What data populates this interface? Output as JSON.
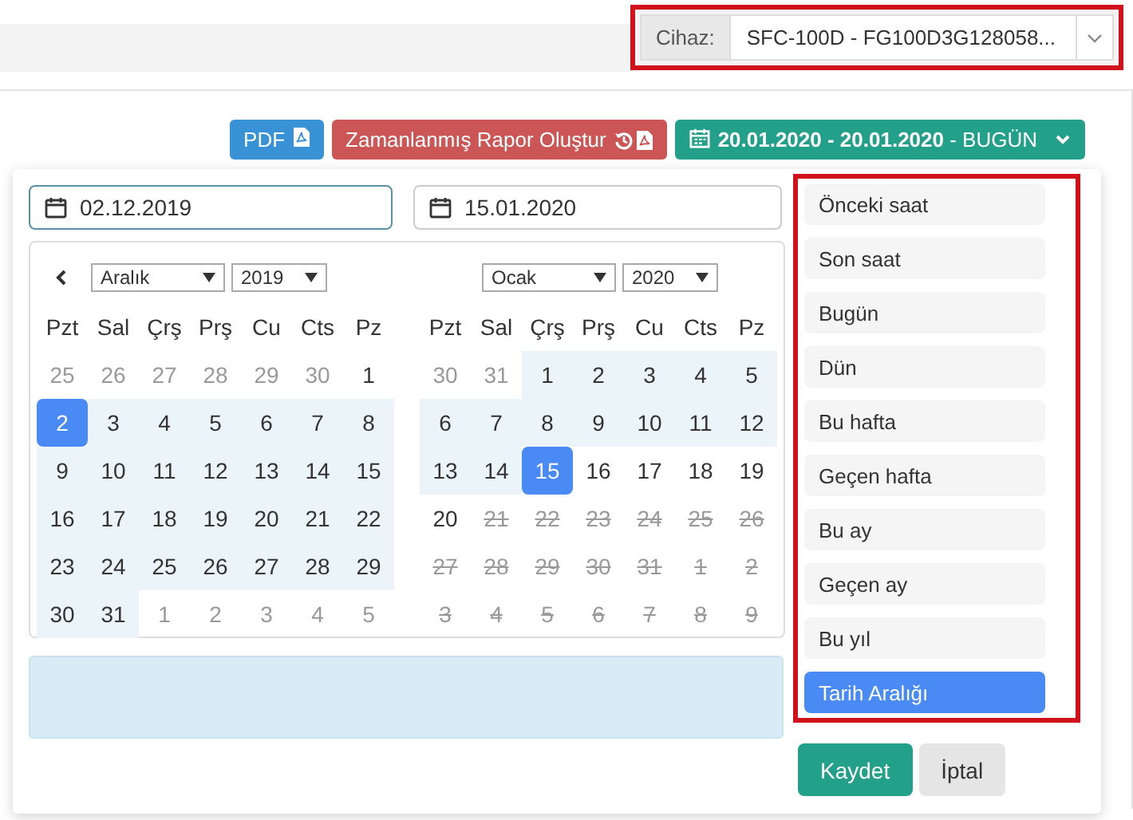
{
  "device_selector": {
    "label": "Cihaz:",
    "value": "SFC-100D - FG100D3G128058..."
  },
  "toolbar": {
    "pdf_button": "PDF",
    "scheduled_report_button": "Zamanlanmış Rapor Oluştur",
    "range_button": "**20.01.2020 - 20.01.2020** - BUGÜN"
  },
  "date_inputs": [
    {
      "value": "02.12.2019",
      "focused": true
    },
    {
      "value": "15.01.2020",
      "focused": false
    }
  ],
  "calendars": [
    {
      "month": "Aralık",
      "year": "2019",
      "weekdays": [
        "Pzt",
        "Sal",
        "Çrş",
        "Prş",
        "Cu",
        "Cts",
        "Pz"
      ],
      "days": [
        {
          "text": "25",
          "kind": "off"
        },
        {
          "text": "26",
          "kind": "off"
        },
        {
          "text": "27",
          "kind": "off"
        },
        {
          "text": "28",
          "kind": "off"
        },
        {
          "text": "29",
          "kind": "off"
        },
        {
          "text": "30",
          "kind": "off"
        },
        {
          "text": "1",
          "kind": "normal"
        },
        {
          "text": "2",
          "kind": "selected"
        },
        {
          "text": "3",
          "kind": "range"
        },
        {
          "text": "4",
          "kind": "range"
        },
        {
          "text": "5",
          "kind": "range"
        },
        {
          "text": "6",
          "kind": "range"
        },
        {
          "text": "7",
          "kind": "range"
        },
        {
          "text": "8",
          "kind": "range"
        },
        {
          "text": "9",
          "kind": "range"
        },
        {
          "text": "10",
          "kind": "range"
        },
        {
          "text": "11",
          "kind": "range"
        },
        {
          "text": "12",
          "kind": "range"
        },
        {
          "text": "13",
          "kind": "range"
        },
        {
          "text": "14",
          "kind": "range"
        },
        {
          "text": "15",
          "kind": "range"
        },
        {
          "text": "16",
          "kind": "range"
        },
        {
          "text": "17",
          "kind": "range"
        },
        {
          "text": "18",
          "kind": "range"
        },
        {
          "text": "19",
          "kind": "range"
        },
        {
          "text": "20",
          "kind": "range"
        },
        {
          "text": "21",
          "kind": "range"
        },
        {
          "text": "22",
          "kind": "range"
        },
        {
          "text": "23",
          "kind": "range"
        },
        {
          "text": "24",
          "kind": "range"
        },
        {
          "text": "25",
          "kind": "range"
        },
        {
          "text": "26",
          "kind": "range"
        },
        {
          "text": "27",
          "kind": "range"
        },
        {
          "text": "28",
          "kind": "range"
        },
        {
          "text": "29",
          "kind": "range"
        },
        {
          "text": "30",
          "kind": "range"
        },
        {
          "text": "31",
          "kind": "range"
        },
        {
          "text": "1",
          "kind": "off"
        },
        {
          "text": "2",
          "kind": "off"
        },
        {
          "text": "3",
          "kind": "off"
        },
        {
          "text": "4",
          "kind": "off"
        },
        {
          "text": "5",
          "kind": "off"
        }
      ]
    },
    {
      "month": "Ocak",
      "year": "2020",
      "weekdays": [
        "Pzt",
        "Sal",
        "Çrş",
        "Prş",
        "Cu",
        "Cts",
        "Pz"
      ],
      "days": [
        {
          "text": "30",
          "kind": "off"
        },
        {
          "text": "31",
          "kind": "off"
        },
        {
          "text": "1",
          "kind": "range"
        },
        {
          "text": "2",
          "kind": "range"
        },
        {
          "text": "3",
          "kind": "range"
        },
        {
          "text": "4",
          "kind": "range"
        },
        {
          "text": "5",
          "kind": "range"
        },
        {
          "text": "6",
          "kind": "range"
        },
        {
          "text": "7",
          "kind": "range"
        },
        {
          "text": "8",
          "kind": "range"
        },
        {
          "text": "9",
          "kind": "range"
        },
        {
          "text": "10",
          "kind": "range"
        },
        {
          "text": "11",
          "kind": "range"
        },
        {
          "text": "12",
          "kind": "range"
        },
        {
          "text": "13",
          "kind": "range"
        },
        {
          "text": "14",
          "kind": "range"
        },
        {
          "text": "15",
          "kind": "selected"
        },
        {
          "text": "16",
          "kind": "normal"
        },
        {
          "text": "17",
          "kind": "normal"
        },
        {
          "text": "18",
          "kind": "normal"
        },
        {
          "text": "19",
          "kind": "normal"
        },
        {
          "text": "20",
          "kind": "normal"
        },
        {
          "text": "21",
          "kind": "disabled"
        },
        {
          "text": "22",
          "kind": "disabled"
        },
        {
          "text": "23",
          "kind": "disabled"
        },
        {
          "text": "24",
          "kind": "disabled"
        },
        {
          "text": "25",
          "kind": "disabled"
        },
        {
          "text": "26",
          "kind": "disabled"
        },
        {
          "text": "27",
          "kind": "disabled"
        },
        {
          "text": "28",
          "kind": "disabled"
        },
        {
          "text": "29",
          "kind": "disabled"
        },
        {
          "text": "30",
          "kind": "disabled"
        },
        {
          "text": "31",
          "kind": "disabled"
        },
        {
          "text": "1",
          "kind": "disabled"
        },
        {
          "text": "2",
          "kind": "disabled"
        },
        {
          "text": "3",
          "kind": "disabled"
        },
        {
          "text": "4",
          "kind": "disabled"
        },
        {
          "text": "5",
          "kind": "disabled"
        },
        {
          "text": "6",
          "kind": "disabled"
        },
        {
          "text": "7",
          "kind": "disabled"
        },
        {
          "text": "8",
          "kind": "disabled"
        },
        {
          "text": "9",
          "kind": "disabled"
        }
      ]
    }
  ],
  "ranges": [
    {
      "label": "Önceki saat",
      "selected": false
    },
    {
      "label": "Son saat",
      "selected": false
    },
    {
      "label": "Bugün",
      "selected": false
    },
    {
      "label": "Dün",
      "selected": false
    },
    {
      "label": "Bu hafta",
      "selected": false
    },
    {
      "label": "Geçen hafta",
      "selected": false
    },
    {
      "label": "Bu ay",
      "selected": false
    },
    {
      "label": "Geçen ay",
      "selected": false
    },
    {
      "label": "Bu yıl",
      "selected": false
    },
    {
      "label": "Tarih Aralığı",
      "selected": true
    }
  ],
  "save_button": "Kaydet",
  "cancel_button": "İptal"
}
